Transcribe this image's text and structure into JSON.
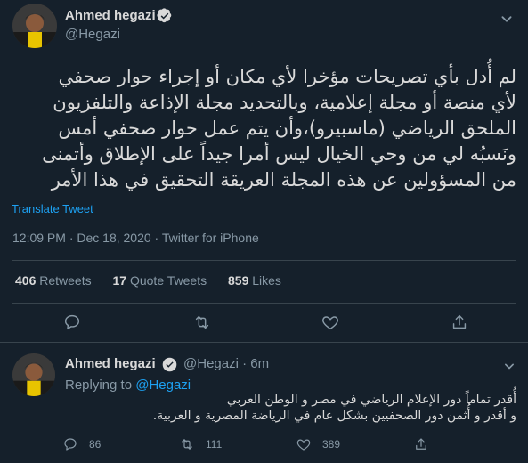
{
  "main_tweet": {
    "author_name": "Ahmed hegazi",
    "handle": "@Hegazi",
    "text_lines": [
      "لم أُدل بأي تصريحات مؤخرا لأي مكان أو إجراء حوار صحفي",
      "لأي منصة أو مجلة إعلامية، وبالتحديد مجلة الإذاعة والتلفزيون",
      "الملحق الرياضي (ماسبيرو)،وأن يتم عمل حوار صحفي أمس",
      "ونَسبُه لي من وحي الخيال ليس أمرا جيداً على الإطلاق وأتمنى",
      "من المسؤولين عن هذه المجلة العريقة التحقيق في هذا الأمر"
    ],
    "translate_label": "Translate Tweet",
    "timestamp": "12:09 PM · Dec 18, 2020 · Twitter for iPhone",
    "stats": {
      "retweets_count": "406",
      "retweets_label": "Retweets",
      "quotes_count": "17",
      "quotes_label": "Quote Tweets",
      "likes_count": "859",
      "likes_label": "Likes"
    }
  },
  "reply": {
    "author_name": "Ahmed hegazi",
    "handle": "@Hegazi",
    "age": "· 6m",
    "replying_prefix": "Replying to",
    "replying_to": "@Hegazi",
    "text_lines": [
      "أُقدر تماماً دور الإعلام الرياضي في مصر و الوطن العربي",
      "و أقدر و أُثمن دور الصحفيين بشكل عام في الرياضة المصرية و العربية."
    ],
    "reply_count": "86",
    "retweet_count": "111",
    "like_count": "389"
  },
  "colors": {
    "background": "#15202b",
    "accent": "#1da1f2",
    "muted": "#8899a6",
    "divider": "#38444d"
  }
}
